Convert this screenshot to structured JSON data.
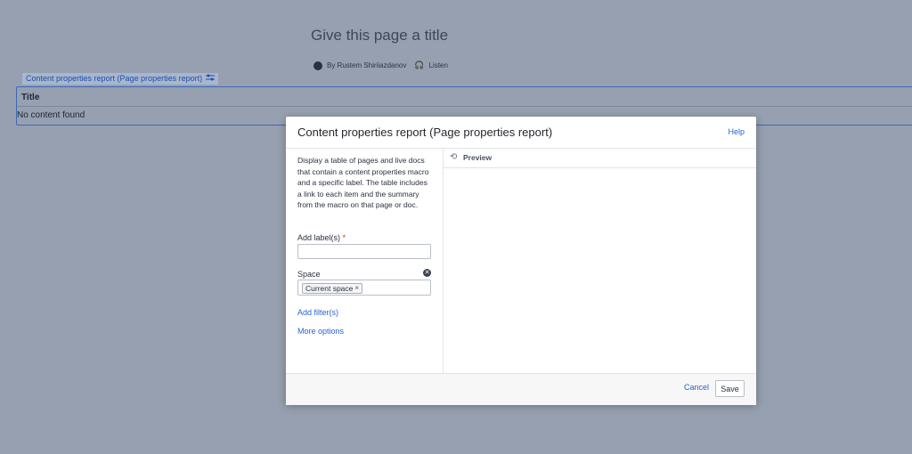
{
  "page": {
    "title": "Give this page a title",
    "author": "By Rustem Shiriiazdanov",
    "listen": "Listen"
  },
  "macro": {
    "label": "Content properties report (Page properties report)",
    "column_header": "Title",
    "empty_text": "No content found"
  },
  "dialog": {
    "title": "Content properties report (Page properties report)",
    "help": "Help",
    "description": "Display a table of pages and live docs that contain a content properties macro and a specific label. The table includes a link to each item and the summary from the macro on that page or doc.",
    "labels_field": {
      "label": "Add label(s)",
      "required": "*",
      "value": ""
    },
    "space_field": {
      "label": "Space",
      "chip": "Current space",
      "chip_remove": "×"
    },
    "add_filter": "Add filter(s)",
    "more_options": "More options",
    "preview": "Preview",
    "cancel": "Cancel",
    "save": "Save"
  },
  "colors": {
    "overlay": "#97a0b0",
    "link": "#2763d4",
    "required": "#d0271d"
  }
}
